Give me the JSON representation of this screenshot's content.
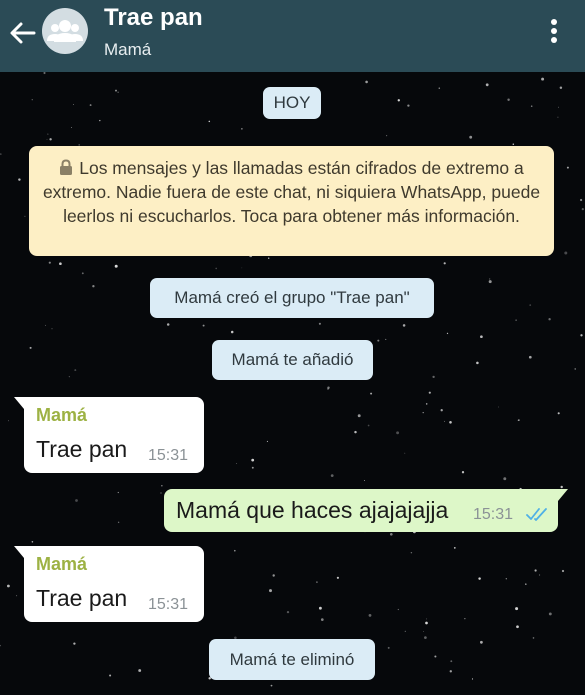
{
  "header": {
    "title": "Trae pan",
    "subtitle": "Mamá",
    "back_icon": "arrow-left-icon",
    "avatar_icon": "group-avatar-icon",
    "menu_icon": "more-vertical-icon",
    "color": "#2b4b56"
  },
  "chat": {
    "date_label": "HOY",
    "encryption_notice": "Los mensajes y las llamadas están cifrados de extremo a extremo. Nadie fuera de este chat, ni siquiera WhatsApp, puede leerlos ni escucharlos. Toca para obtener más información.",
    "system_created": "Mamá creó el grupo \"Trae pan\"",
    "system_added": "Mamá te añadió",
    "system_removed": "Mamá te eliminó",
    "messages": [
      {
        "direction": "in",
        "sender": "Mamá",
        "text": "Trae pan",
        "time": "15:31"
      },
      {
        "direction": "out",
        "text": "Mamá que haces ajajajajja",
        "time": "15:31",
        "status": "read",
        "status_icon": "double-check-icon"
      },
      {
        "direction": "in",
        "sender": "Mamá",
        "text": "Trae pan",
        "time": "15:31"
      }
    ]
  },
  "colors": {
    "incoming_bubble": "#ffffff",
    "outgoing_bubble": "#ddf7c8",
    "system_bubble": "#dbecf6",
    "encryption_bubble": "#fdefc5",
    "sender_name": "#9db244",
    "read_ticks": "#4fb0e6"
  }
}
